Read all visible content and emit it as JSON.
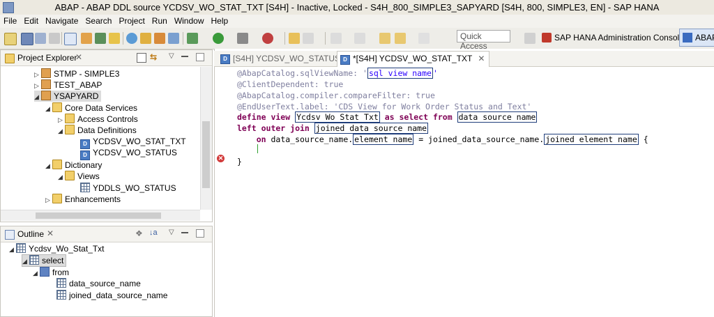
{
  "window": {
    "title": "ABAP - ABAP DDL source YCDSV_WO_STAT_TXT [S4H] - Inactive, Locked - S4H_800_SIMPLE3_SAPYARD [S4H, 800, SIMPLE3, EN] - SAP HANA"
  },
  "menu": [
    "File",
    "Edit",
    "Navigate",
    "Search",
    "Project",
    "Run",
    "Window",
    "Help"
  ],
  "toolbar": {
    "quick_access_placeholder": "Quick Access",
    "perspective_hana": "SAP HANA Administration Console",
    "perspective_abap": "ABAP"
  },
  "project_explorer": {
    "title": "Project Explorer",
    "items": [
      {
        "label": "STMP - SIMPLE3"
      },
      {
        "label": "TEST_ABAP"
      },
      {
        "label": "YSAPYARD"
      },
      {
        "label": "Core Data Services"
      },
      {
        "label": "Access Controls"
      },
      {
        "label": "Data Definitions"
      },
      {
        "label": "YCDSV_WO_STAT_TXT"
      },
      {
        "label": "YCDSV_WO_STATUS"
      },
      {
        "label": "Dictionary"
      },
      {
        "label": "Views"
      },
      {
        "label": "YDDLS_WO_STATUS"
      },
      {
        "label": "Enhancements"
      }
    ]
  },
  "outline": {
    "title": "Outline",
    "items": [
      {
        "label": "Ycdsv_Wo_Stat_Txt"
      },
      {
        "label": "select"
      },
      {
        "label": "from"
      },
      {
        "label": "data_source_name"
      },
      {
        "label": "joined_data_source_name"
      }
    ]
  },
  "editor": {
    "tabs": [
      {
        "label": "[S4H] YCDSV_WO_STATUS",
        "active": false
      },
      {
        "label": "*[S4H] YCDSV_WO_STAT_TXT",
        "active": true
      }
    ],
    "lines": [
      {
        "parts": [
          {
            "t": "@AbapCatalog.sqlViewName: '",
            "c": "ann"
          },
          {
            "t": "sql view name",
            "c": "str",
            "box": true
          },
          {
            "t": "'",
            "c": "str"
          }
        ]
      },
      {
        "parts": [
          {
            "t": "@ClientDependent: true",
            "c": "ann"
          }
        ]
      },
      {
        "parts": [
          {
            "t": "@AbapCatalog.compiler.compareFilter: true",
            "c": "ann"
          }
        ]
      },
      {
        "parts": [
          {
            "t": "@EndUserText.label: 'CDS View for Work Order Status and Text'",
            "c": "ann"
          }
        ]
      },
      {
        "parts": [
          {
            "t": "define view ",
            "c": "kw"
          },
          {
            "t": "Ycdsv Wo Stat Txt",
            "c": "plain",
            "box": true
          },
          {
            "t": " as select from ",
            "c": "kw"
          },
          {
            "t": "data source name",
            "c": "plain",
            "box": true
          }
        ]
      },
      {
        "parts": [
          {
            "t": "left outer join ",
            "c": "kw"
          },
          {
            "t": "joined data source name",
            "c": "plain",
            "box": true
          }
        ]
      },
      {
        "parts": [
          {
            "t": "    on ",
            "c": "kw"
          },
          {
            "t": "data_source_name.",
            "c": "plain"
          },
          {
            "t": "element name",
            "c": "plain",
            "box": true
          },
          {
            "t": " = joined_data_source_name.",
            "c": "plain"
          },
          {
            "t": "joined element name",
            "c": "plain",
            "box": true
          },
          {
            "t": " {",
            "c": "plain"
          }
        ]
      },
      {
        "parts": [
          {
            "t": "",
            "c": "plain"
          }
        ]
      },
      {
        "parts": [
          {
            "t": "}",
            "c": "plain"
          }
        ]
      }
    ]
  }
}
